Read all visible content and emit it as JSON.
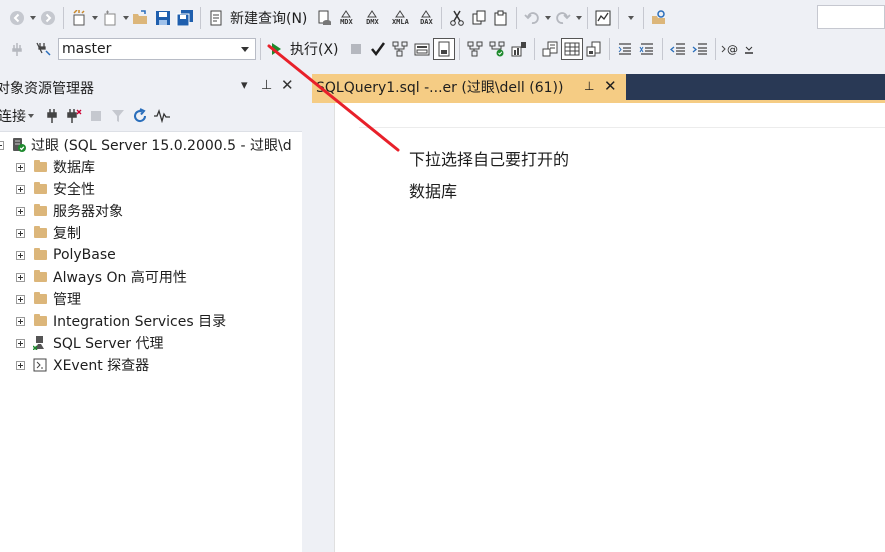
{
  "toolbar": {
    "new_query_label": "新建查询(N)",
    "query_types": [
      "MDX",
      "DMX",
      "XMLA",
      "DAX"
    ],
    "database_selector": {
      "selected": "master"
    },
    "execute_label": "执行(X)"
  },
  "object_explorer": {
    "title": "对象资源管理器",
    "connect_label": "连接",
    "server_node": "过眼 (SQL Server 15.0.2000.5 - 过眼\\d",
    "nodes": [
      {
        "label": "数据库",
        "icon": "folder-icon"
      },
      {
        "label": "安全性",
        "icon": "folder-icon"
      },
      {
        "label": "服务器对象",
        "icon": "folder-icon"
      },
      {
        "label": "复制",
        "icon": "folder-icon"
      },
      {
        "label": "PolyBase",
        "icon": "folder-icon"
      },
      {
        "label": "Always On 高可用性",
        "icon": "folder-icon"
      },
      {
        "label": "管理",
        "icon": "folder-icon"
      },
      {
        "label": "Integration Services 目录",
        "icon": "folder-icon"
      },
      {
        "label": "SQL Server 代理",
        "icon": "sql-agent-icon"
      },
      {
        "label": "XEvent 探查器",
        "icon": "xevent-icon"
      }
    ]
  },
  "document_tab": {
    "title": "SQLQuery1.sql -...er (过眼\\dell (61))"
  },
  "annotation": {
    "line1": "下拉选择自己要打开的",
    "line2": "数据库",
    "color": "#e8202a"
  },
  "colors": {
    "tab_active": "#f5cc84",
    "tab_bar": "#293955",
    "chrome": "#eef0f5"
  }
}
